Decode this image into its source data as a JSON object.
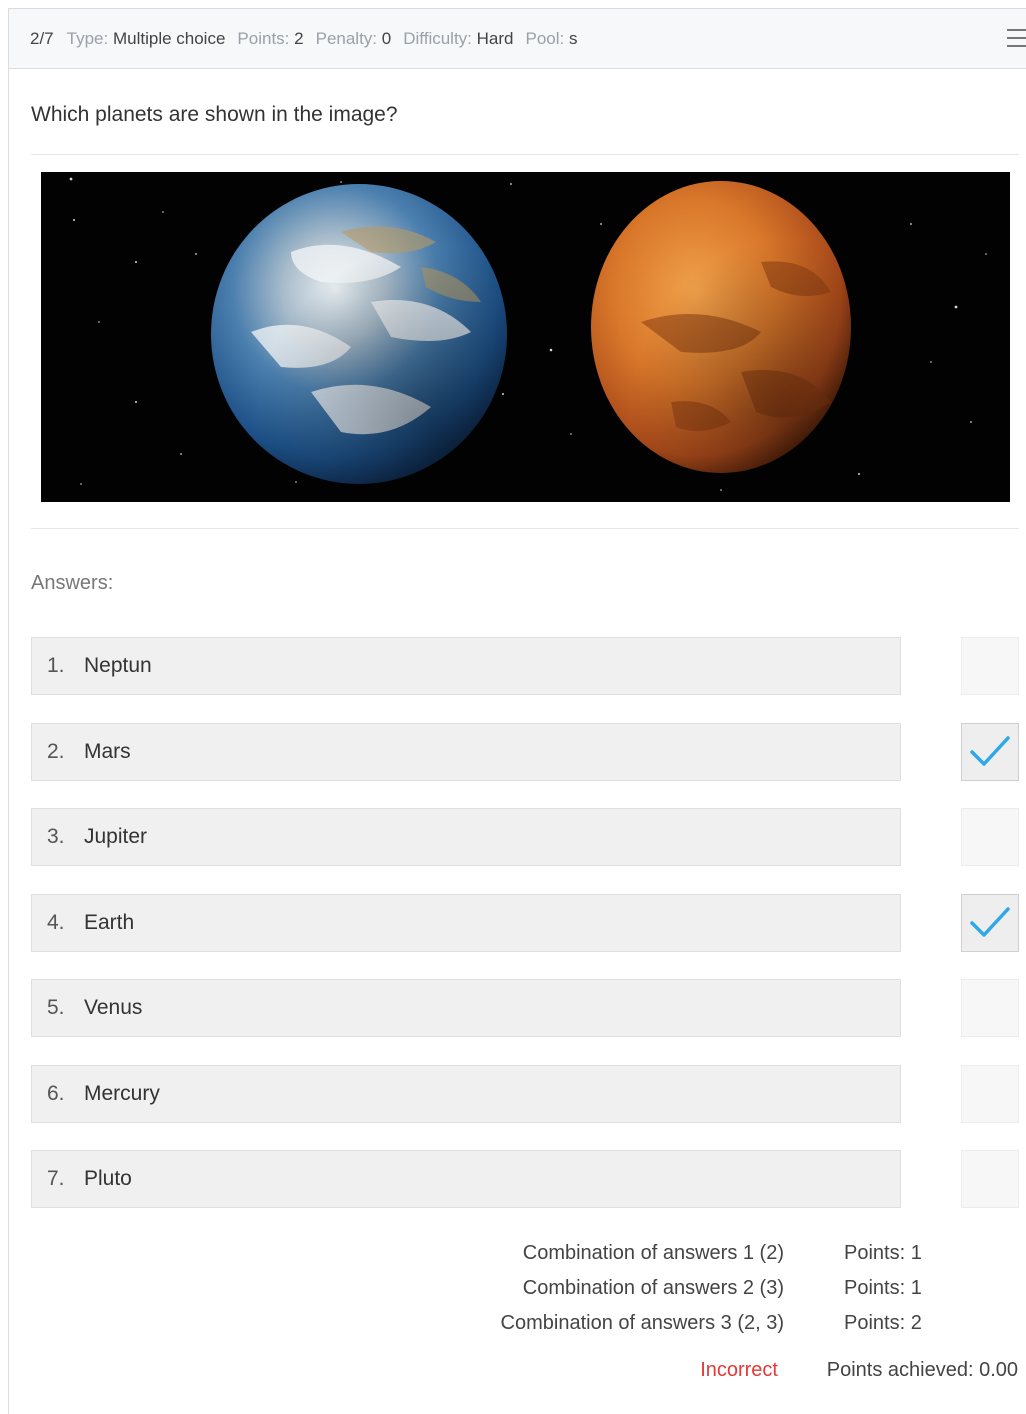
{
  "header": {
    "position": "2/7",
    "type_label": "Type:",
    "type_value": "Multiple choice",
    "points_label": "Points:",
    "points_value": "2",
    "penalty_label": "Penalty:",
    "penalty_value": "0",
    "difficulty_label": "Difficulty:",
    "difficulty_value": "Hard",
    "pool_label": "Pool:",
    "pool_value": "s",
    "menu_icon": "hamburger-menu-icon"
  },
  "question": {
    "text": "Which planets are shown in the image?",
    "image": "earth-and-mars-image"
  },
  "answers_label": "Answers:",
  "answers": [
    {
      "index": "1.",
      "label": "Neptun",
      "checked": false
    },
    {
      "index": "2.",
      "label": "Mars",
      "checked": true
    },
    {
      "index": "3.",
      "label": "Jupiter",
      "checked": false
    },
    {
      "index": "4.",
      "label": "Earth",
      "checked": true
    },
    {
      "index": "5.",
      "label": "Venus",
      "checked": false
    },
    {
      "index": "6.",
      "label": "Mercury",
      "checked": false
    },
    {
      "index": "7.",
      "label": "Pluto",
      "checked": false
    }
  ],
  "combinations": [
    {
      "label": "Combination of answers 1 (2)",
      "points": "Points: 1"
    },
    {
      "label": "Combination of answers 2 (3)",
      "points": "Points: 1"
    },
    {
      "label": "Combination of answers 3 (2, 3)",
      "points": "Points: 2"
    }
  ],
  "result": {
    "status": "Incorrect",
    "points_achieved": "Points achieved: 0.00"
  },
  "colors": {
    "check_blue": "#2ea8e6",
    "incorrect_red": "#e53935"
  }
}
